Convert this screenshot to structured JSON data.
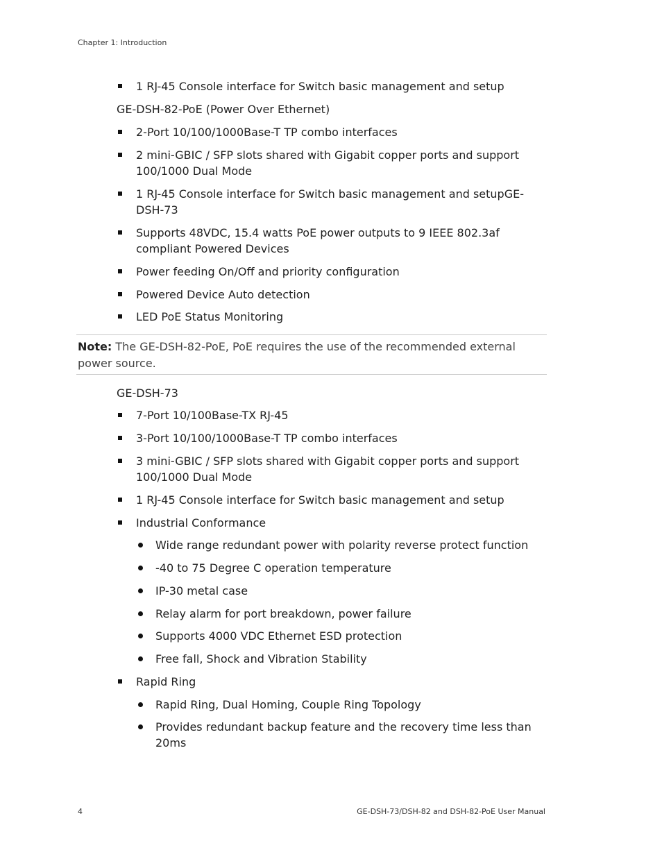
{
  "header": {
    "chapter": "Chapter 1: Introduction"
  },
  "items": [
    {
      "type": "square",
      "lines": [
        "1 RJ-45 Console interface for Switch basic management and setup"
      ]
    },
    {
      "type": "heading",
      "lines": [
        "GE-DSH-82-PoE (Power Over Ethernet)"
      ]
    },
    {
      "type": "square",
      "lines": [
        "2-Port 10/100/1000Base-T TP combo interfaces"
      ]
    },
    {
      "type": "square",
      "lines": [
        "2 mini-GBIC / SFP slots shared with Gigabit copper ports and support",
        "100/1000 Dual Mode"
      ]
    },
    {
      "type": "square",
      "lines": [
        "1 RJ-45 Console interface for Switch basic management and setupGE-",
        "DSH-73"
      ]
    },
    {
      "type": "square",
      "lines": [
        "Supports 48VDC, 15.4 watts PoE power outputs to 9 IEEE 802.3af",
        "compliant Powered Devices"
      ]
    },
    {
      "type": "square",
      "lines": [
        "Power feeding On/Off and priority configuration"
      ]
    },
    {
      "type": "square",
      "lines": [
        "Powered Device Auto detection"
      ]
    },
    {
      "type": "square",
      "lines": [
        "LED PoE Status Monitoring"
      ]
    }
  ],
  "note": {
    "label": "Note:",
    "text": " The GE-DSH-82-PoE, PoE requires the use of the recommended external power source."
  },
  "items2": [
    {
      "type": "heading",
      "lines": [
        "GE-DSH-73"
      ]
    },
    {
      "type": "square",
      "lines": [
        "7-Port 10/100Base-TX RJ-45"
      ]
    },
    {
      "type": "square",
      "lines": [
        "3-Port 10/100/1000Base-T TP combo interfaces"
      ]
    },
    {
      "type": "square",
      "lines": [
        "3 mini-GBIC / SFP slots shared with Gigabit copper ports and support",
        "100/1000 Dual Mode"
      ]
    },
    {
      "type": "square",
      "lines": [
        "1 RJ-45 Console interface for Switch basic management and setup"
      ]
    },
    {
      "type": "square",
      "lines": [
        "Industrial Conformance"
      ]
    },
    {
      "type": "dot",
      "lines": [
        "Wide range redundant power with polarity reverse protect function"
      ]
    },
    {
      "type": "dot",
      "lines": [
        "-40 to 75 Degree C operation temperature"
      ]
    },
    {
      "type": "dot",
      "lines": [
        "IP-30 metal case"
      ]
    },
    {
      "type": "dot",
      "lines": [
        "Relay alarm for port breakdown, power failure"
      ]
    },
    {
      "type": "dot",
      "lines": [
        "Supports 4000 VDC Ethernet ESD protection"
      ]
    },
    {
      "type": "dot",
      "lines": [
        "Free fall, Shock and Vibration Stability"
      ]
    },
    {
      "type": "square",
      "lines": [
        "Rapid Ring"
      ]
    },
    {
      "type": "dot",
      "lines": [
        "Rapid Ring, Dual Homing, Couple Ring Topology"
      ]
    },
    {
      "type": "dot",
      "lines": [
        "Provides redundant backup feature and the recovery time less than",
        "20ms"
      ]
    }
  ],
  "footer": {
    "page_number": "4",
    "manual_title": "GE-DSH-73/DSH-82 and DSH-82-PoE User Manual"
  }
}
